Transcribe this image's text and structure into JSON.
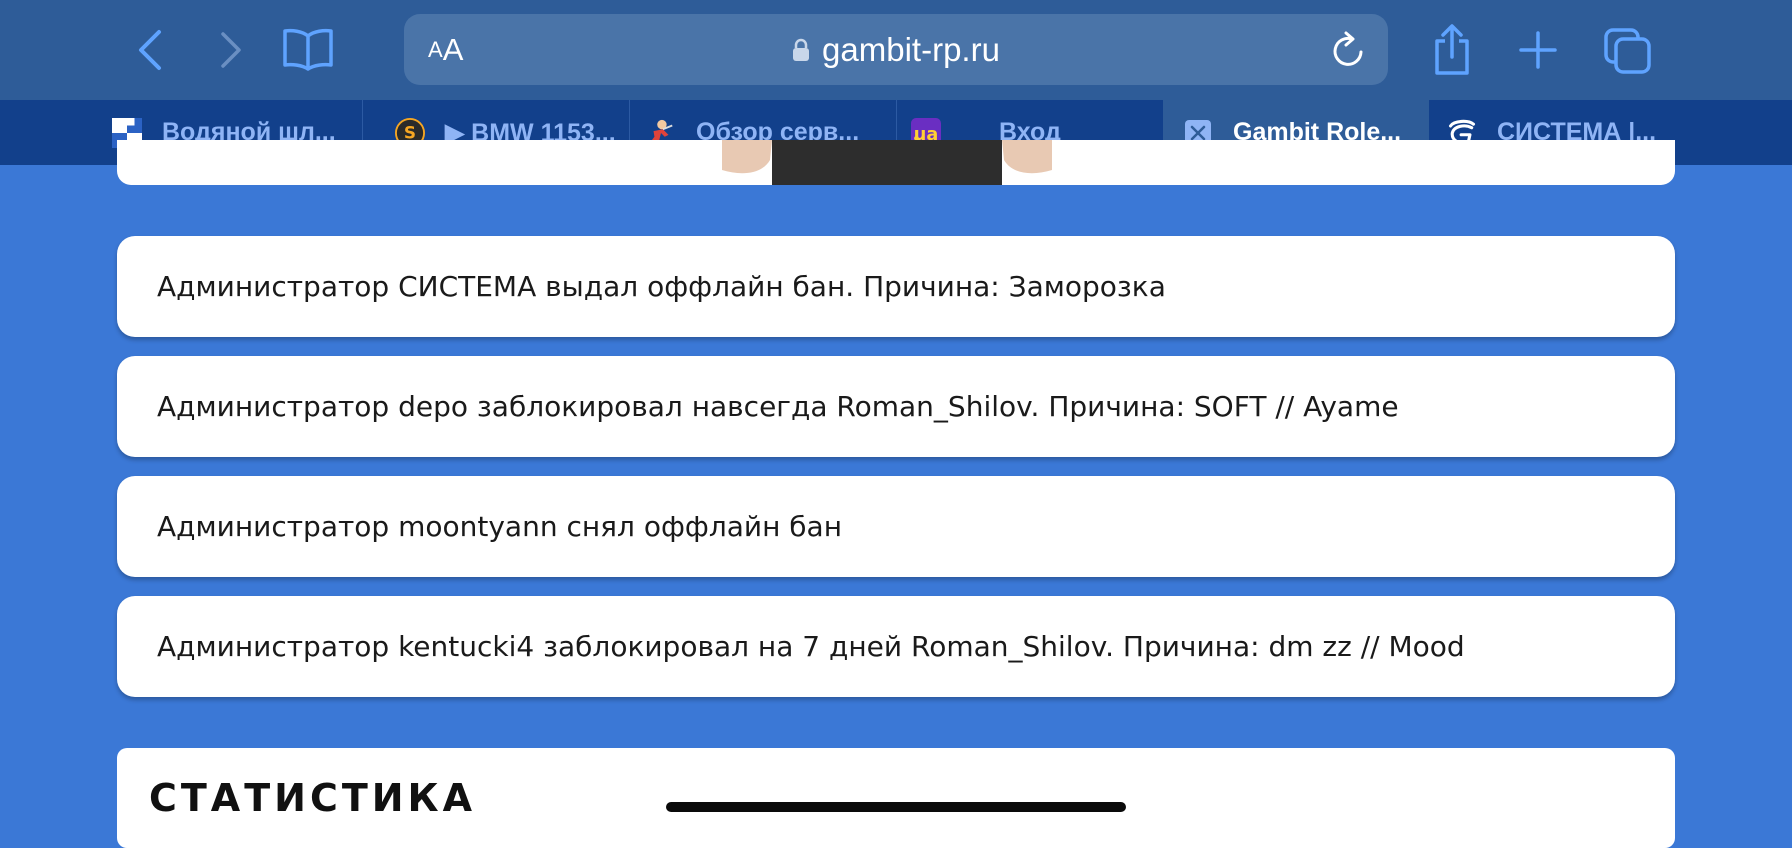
{
  "browser": {
    "url": "gambit-rp.ru",
    "text_size_small": "A",
    "text_size_big": "A",
    "tabs": [
      {
        "label": "Водяной шл...",
        "favicon": "blue-white-squares-icon",
        "active": false
      },
      {
        "label": "▶ BMW 1153...",
        "favicon": "orange-s-icon",
        "active": false
      },
      {
        "label": "Обзор серв...",
        "favicon": "game-character-icon",
        "active": false
      },
      {
        "label": "Вход",
        "favicon": "ua-logo-icon",
        "active": false
      },
      {
        "label": "Gambit Role...",
        "favicon": "close-x-icon",
        "active": true
      },
      {
        "label": "СИСТЕМА |...",
        "favicon": "gambit-g-icon",
        "active": false
      }
    ]
  },
  "log": {
    "items": [
      "Администратор СИСТЕМА выдал оффлайн бан. Причина: Заморозка",
      "Администратор depo заблокировал навсегда Roman_Shilov. Причина: SOFT // Ayame",
      "Администратор moontyann снял оффлайн бан",
      "Администратор kentucki4 заблокировал на 7 дней Roman_Shilov. Причина: dm zz // Mood"
    ]
  },
  "stats": {
    "title": "СТАТИСТИКА"
  },
  "colors": {
    "page_background": "#3b78d6",
    "toolbar": "#2e5c98",
    "tabbar": "#12408b",
    "accent": "#5fa3ff"
  }
}
